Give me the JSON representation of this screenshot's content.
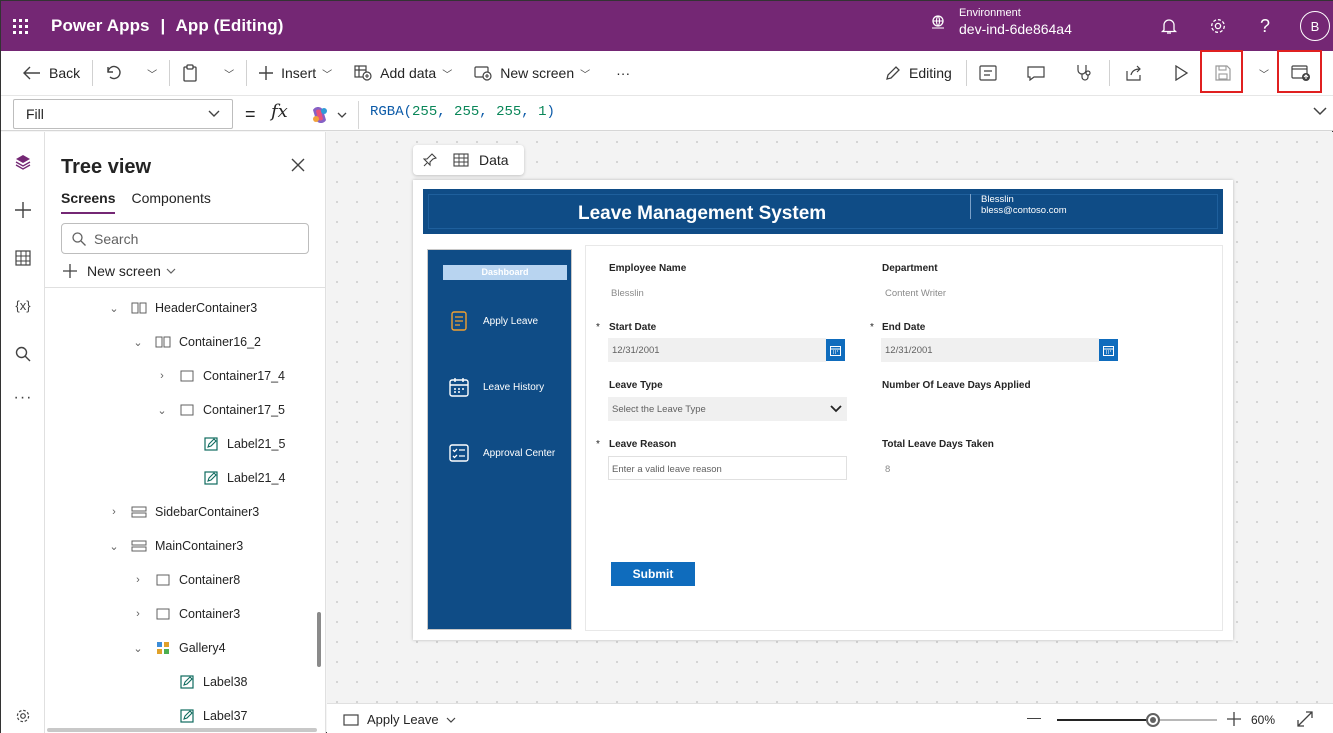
{
  "topbar": {
    "product": "Power Apps",
    "separator": "|",
    "app_state": "App (Editing)",
    "environment_label": "Environment",
    "environment_value": "dev-ind-6de864a4",
    "avatar_initial": "B",
    "bg_color": "#742774"
  },
  "cmdbar": {
    "back": "Back",
    "insert": "Insert",
    "add_data": "Add data",
    "new_screen": "New screen",
    "more": "···",
    "editing": "Editing"
  },
  "formula": {
    "property": "Fill",
    "equals": "=",
    "fx": "fx",
    "fn": "RGBA",
    "args": [
      "255",
      "255",
      "255",
      "1"
    ]
  },
  "tree": {
    "title": "Tree view",
    "tabs": [
      "Screens",
      "Components"
    ],
    "search_placeholder": "Search",
    "new_screen": "New screen",
    "nodes": [
      {
        "label": "HeaderContainer3",
        "arrow": "⌄",
        "icon": "horizontal-container"
      },
      {
        "label": "Container16_2",
        "arrow": "⌄",
        "icon": "horizontal-container"
      },
      {
        "label": "Container17_4",
        "arrow": "›",
        "icon": "container"
      },
      {
        "label": "Container17_5",
        "arrow": "⌄",
        "icon": "container"
      },
      {
        "label": "Label21_5",
        "arrow": "",
        "icon": "label"
      },
      {
        "label": "Label21_4",
        "arrow": "",
        "icon": "label"
      },
      {
        "label": "SidebarContainer3",
        "arrow": "›",
        "icon": "vertical-container"
      },
      {
        "label": "MainContainer3",
        "arrow": "⌄",
        "icon": "vertical-container"
      },
      {
        "label": "Container8",
        "arrow": "›",
        "icon": "container"
      },
      {
        "label": "Container3",
        "arrow": "›",
        "icon": "container"
      },
      {
        "label": "Gallery4",
        "arrow": "⌄",
        "icon": "gallery"
      },
      {
        "label": "Label38",
        "arrow": "",
        "icon": "label"
      },
      {
        "label": "Label37",
        "arrow": "",
        "icon": "label"
      }
    ]
  },
  "canvas": {
    "data_chip": "Data"
  },
  "app": {
    "title": "Leave Management System",
    "user_name": "Blesslin",
    "user_email": "bless@contoso.com",
    "header_color": "#0f4c86",
    "sidebar": {
      "dashboard": "Dashboard",
      "items": [
        "Apply Leave",
        "Leave History",
        "Approval Center"
      ]
    },
    "form": {
      "employee_name_label": "Employee Name",
      "employee_name_value": "Blesslin",
      "department_label": "Department",
      "department_value": "Content Writer",
      "required_mark": "*",
      "start_date_label": "Start Date",
      "start_date_value": "12/31/2001",
      "end_date_label": "End Date",
      "end_date_value": "12/31/2001",
      "leave_type_label": "Leave Type",
      "leave_type_placeholder": "Select the Leave Type",
      "num_days_label": "Number Of Leave Days Applied",
      "reason_label": "Leave Reason",
      "reason_placeholder": "Enter a valid leave reason",
      "total_days_label": "Total Leave Days Taken",
      "total_days_value": "8",
      "submit": "Submit"
    }
  },
  "statusbar": {
    "screen": "Apply Leave",
    "zoom": "60%",
    "zoom_level": 0.6
  }
}
